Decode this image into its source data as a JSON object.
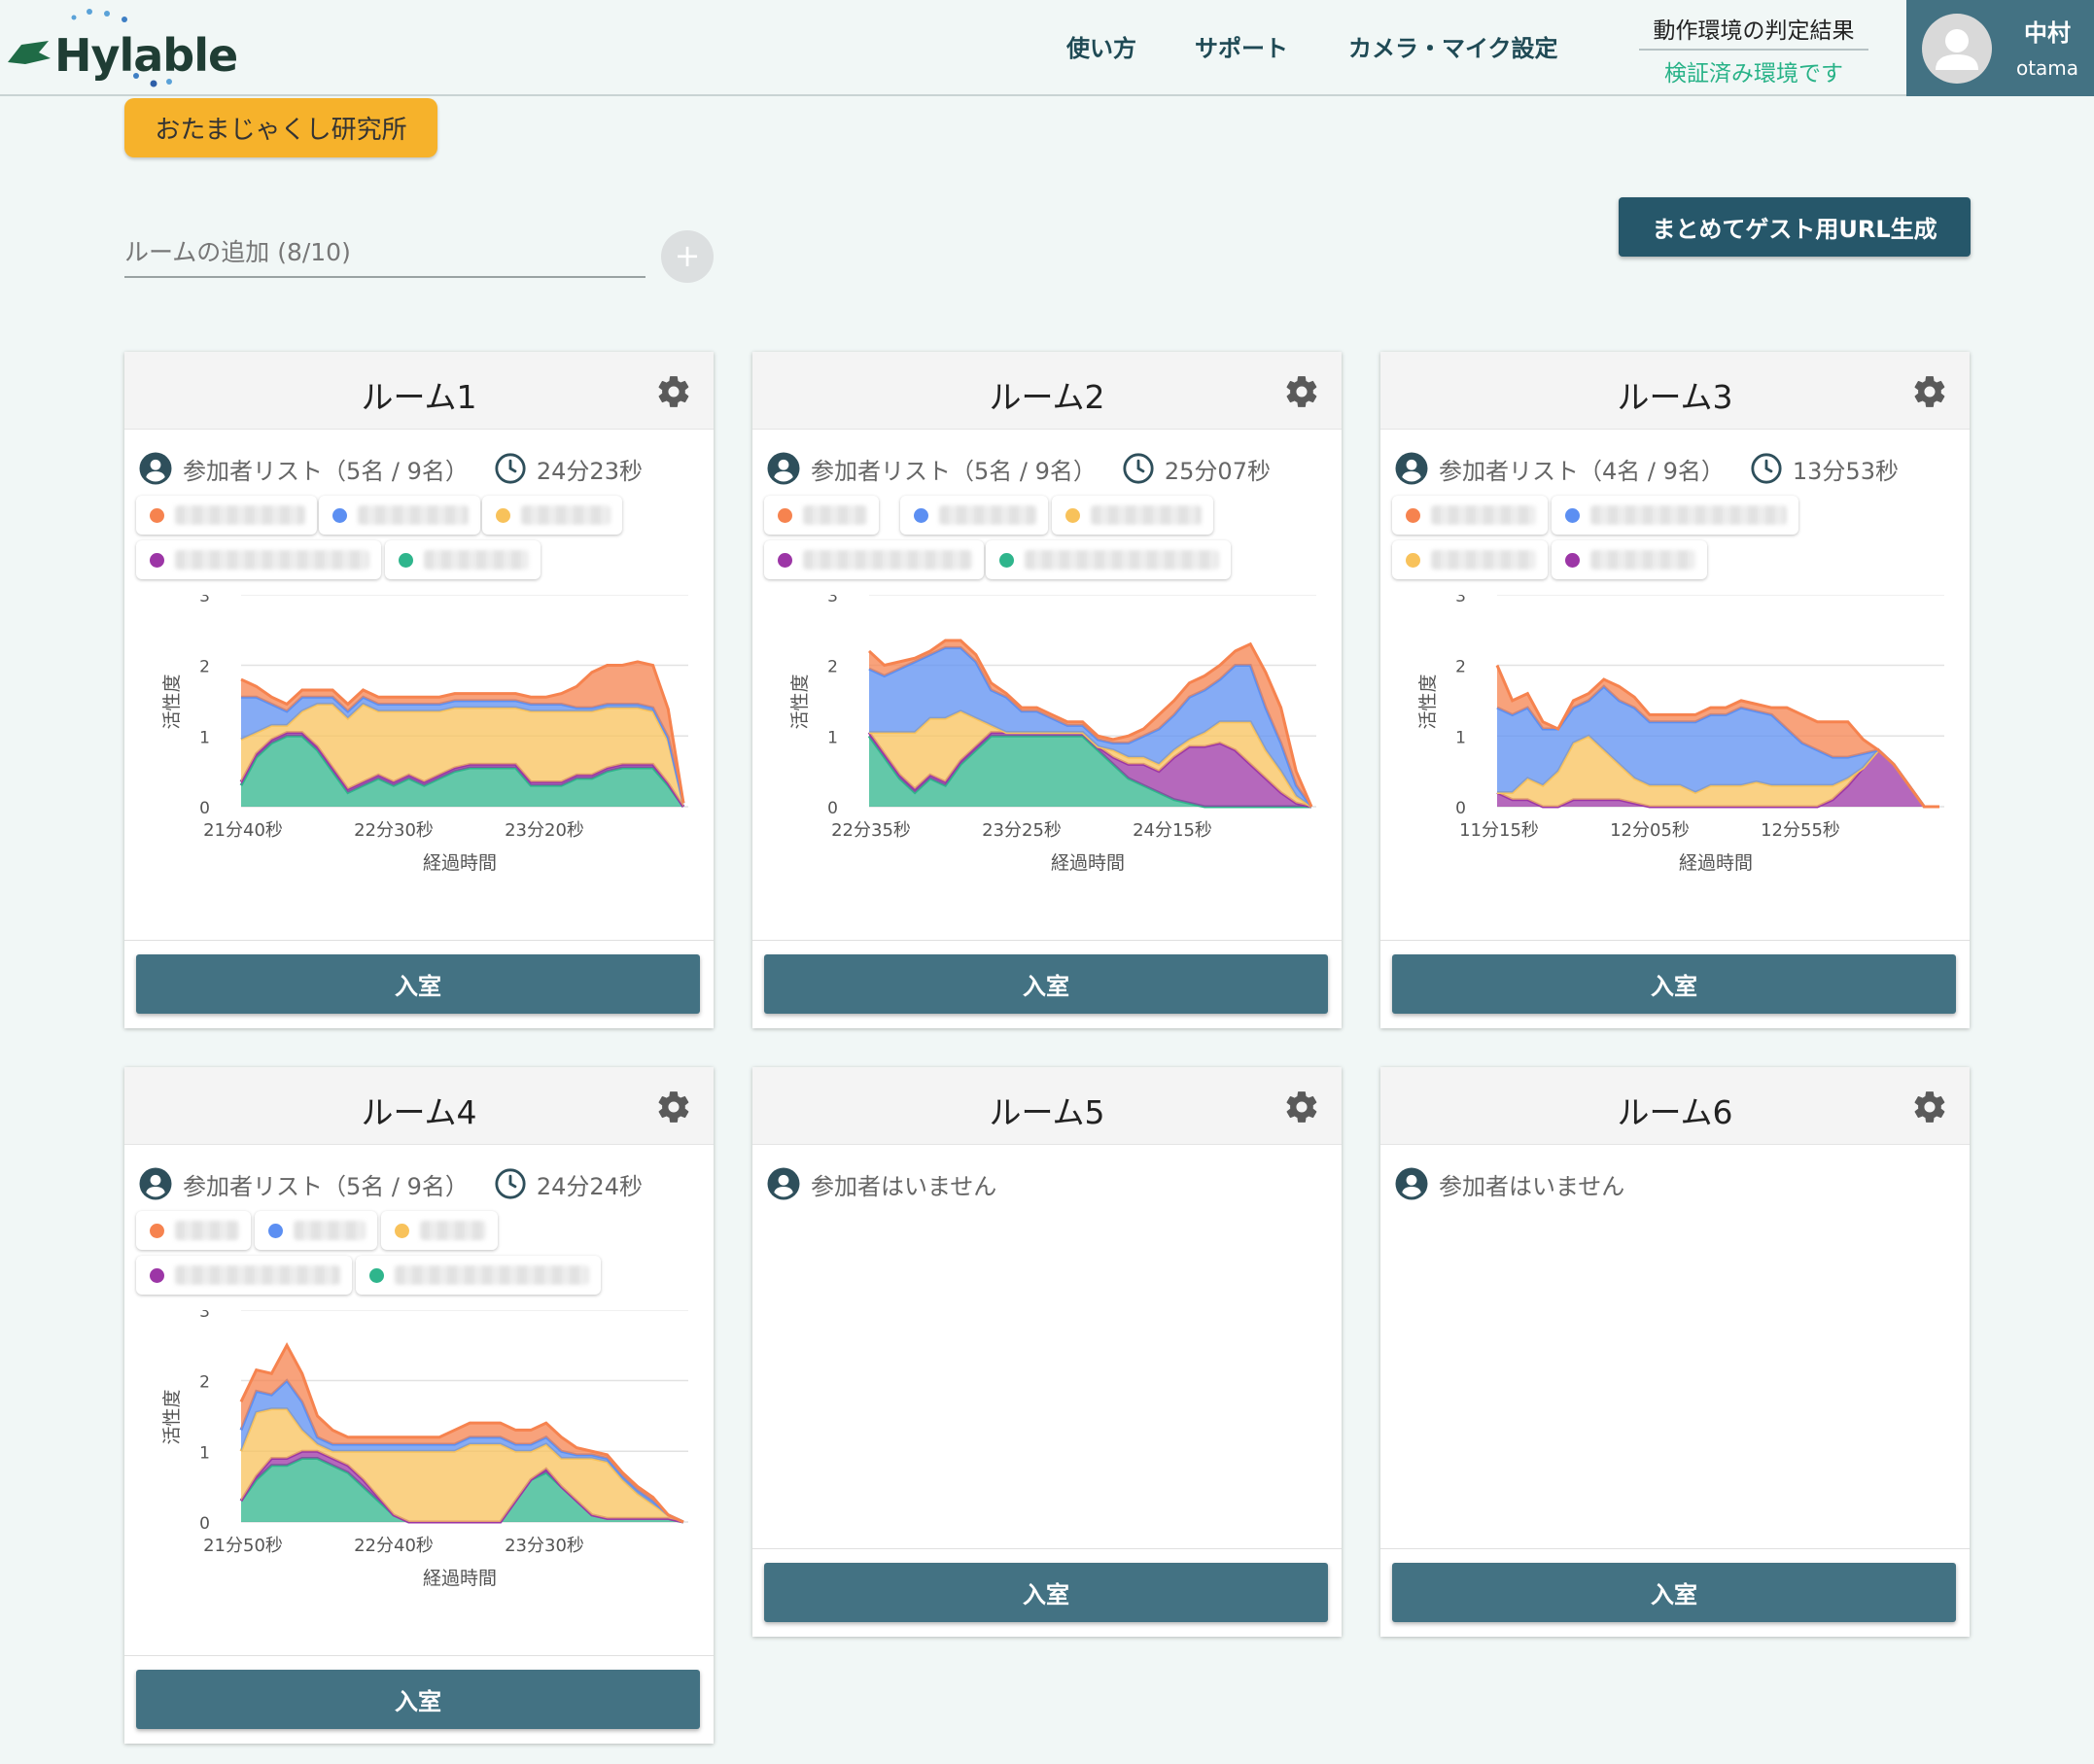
{
  "header": {
    "logo_text": "Hylable",
    "nav": [
      "使い方",
      "サポート",
      "カメラ・マイク設定"
    ],
    "env_title": "動作環境の判定結果",
    "env_status": "検証済み環境です",
    "user_name": "中村",
    "user_id": "otama"
  },
  "org_label": "おたまじゃくし研究所",
  "add_room": {
    "label": "ルームの追加 (8/10)",
    "plus": "+"
  },
  "guest_url_button": "まとめてゲスト用URL生成",
  "colors": {
    "orange": "#f6834f",
    "blue": "#5c8ff2",
    "yellow": "#f8c25b",
    "purple": "#9c36a6",
    "green": "#2fb58c"
  },
  "rooms": [
    {
      "title": "ルーム1",
      "participants_label": "参加者リスト（5名 / 9名）",
      "duration": "24分23秒",
      "chips": [
        "orange",
        "blue",
        "yellow",
        "purple",
        "green"
      ],
      "enter_label": "入室",
      "chart_data": {
        "type": "area",
        "stacked": true,
        "ylabel": "活性度",
        "xlabel": "経過時間",
        "ylim": [
          0,
          3
        ],
        "yticks": [
          "0",
          "1",
          "2",
          "3"
        ],
        "xticks": [
          {
            "at": 0,
            "label": "21分40秒"
          },
          {
            "at": 10,
            "label": "22分30秒"
          },
          {
            "at": 20,
            "label": "23分20秒"
          }
        ],
        "x_count": 30,
        "series": [
          {
            "color": "green",
            "values": [
              0.3,
              0.7,
              0.9,
              1.0,
              1.0,
              0.8,
              0.5,
              0.2,
              0.3,
              0.4,
              0.3,
              0.4,
              0.3,
              0.4,
              0.5,
              0.55,
              0.55,
              0.55,
              0.55,
              0.3,
              0.3,
              0.3,
              0.4,
              0.4,
              0.5,
              0.55,
              0.55,
              0.55,
              0.3,
              0.0
            ]
          },
          {
            "color": "purple",
            "values": [
              0.05,
              0.05,
              0.05,
              0.05,
              0.05,
              0.05,
              0.05,
              0.05,
              0.05,
              0.05,
              0.05,
              0.05,
              0.05,
              0.05,
              0.05,
              0.05,
              0.05,
              0.05,
              0.05,
              0.05,
              0.05,
              0.05,
              0.05,
              0.05,
              0.05,
              0.05,
              0.05,
              0.05,
              0.03,
              0.0
            ]
          },
          {
            "color": "yellow",
            "values": [
              0.6,
              0.3,
              0.2,
              0.1,
              0.3,
              0.6,
              0.9,
              1.0,
              1.1,
              0.9,
              1.0,
              0.9,
              1.0,
              0.9,
              0.85,
              0.8,
              0.8,
              0.8,
              0.8,
              1.0,
              1.0,
              1.0,
              0.9,
              0.9,
              0.85,
              0.8,
              0.8,
              0.75,
              0.6,
              0.05
            ]
          },
          {
            "color": "blue",
            "values": [
              0.6,
              0.5,
              0.3,
              0.2,
              0.2,
              0.1,
              0.1,
              0.1,
              0.1,
              0.1,
              0.1,
              0.1,
              0.1,
              0.1,
              0.1,
              0.1,
              0.1,
              0.1,
              0.1,
              0.1,
              0.1,
              0.1,
              0.05,
              0.05,
              0.05,
              0.05,
              0.05,
              0.05,
              0.05,
              0.0
            ]
          },
          {
            "color": "orange",
            "values": [
              0.25,
              0.15,
              0.1,
              0.1,
              0.1,
              0.1,
              0.1,
              0.1,
              0.1,
              0.1,
              0.1,
              0.1,
              0.1,
              0.1,
              0.1,
              0.1,
              0.1,
              0.1,
              0.1,
              0.1,
              0.1,
              0.15,
              0.3,
              0.5,
              0.55,
              0.55,
              0.6,
              0.6,
              0.4,
              0.0
            ]
          }
        ]
      }
    },
    {
      "title": "ルーム2",
      "participants_label": "参加者リスト（5名 / 9名）",
      "duration": "25分07秒",
      "chips": [
        "orange",
        "blue",
        "yellow",
        "purple",
        "green"
      ],
      "enter_label": "入室",
      "chart_data": {
        "type": "area",
        "stacked": true,
        "ylabel": "活性度",
        "xlabel": "経過時間",
        "ylim": [
          0,
          3
        ],
        "yticks": [
          "0",
          "1",
          "2",
          "3"
        ],
        "xticks": [
          {
            "at": 0,
            "label": "22分35秒"
          },
          {
            "at": 10,
            "label": "23分25秒"
          },
          {
            "at": 20,
            "label": "24分15秒"
          }
        ],
        "x_count": 30,
        "series": [
          {
            "color": "green",
            "values": [
              1.0,
              0.7,
              0.4,
              0.2,
              0.4,
              0.3,
              0.6,
              0.8,
              1.0,
              1.0,
              1.0,
              1.0,
              1.0,
              1.0,
              1.0,
              0.8,
              0.6,
              0.4,
              0.3,
              0.2,
              0.1,
              0.05,
              0.0,
              0.0,
              0.0,
              0.0,
              0.0,
              0.0,
              0.0,
              0.0
            ]
          },
          {
            "color": "purple",
            "values": [
              0.05,
              0.05,
              0.05,
              0.05,
              0.05,
              0.05,
              0.05,
              0.05,
              0.05,
              0.05,
              0.05,
              0.05,
              0.05,
              0.05,
              0.05,
              0.05,
              0.1,
              0.2,
              0.3,
              0.3,
              0.6,
              0.8,
              0.85,
              0.9,
              0.8,
              0.6,
              0.4,
              0.2,
              0.05,
              0.0
            ]
          },
          {
            "color": "yellow",
            "values": [
              0.0,
              0.3,
              0.6,
              0.8,
              0.8,
              0.9,
              0.7,
              0.4,
              0.1,
              0.0,
              0.0,
              0.0,
              0.0,
              0.0,
              0.0,
              0.0,
              0.1,
              0.1,
              0.1,
              0.1,
              0.1,
              0.1,
              0.2,
              0.3,
              0.4,
              0.6,
              0.4,
              0.3,
              0.1,
              0.0
            ]
          },
          {
            "color": "blue",
            "values": [
              0.9,
              0.8,
              0.9,
              1.0,
              0.9,
              1.0,
              0.9,
              0.8,
              0.5,
              0.5,
              0.3,
              0.3,
              0.2,
              0.1,
              0.1,
              0.1,
              0.1,
              0.2,
              0.3,
              0.5,
              0.5,
              0.6,
              0.6,
              0.6,
              0.8,
              0.8,
              0.6,
              0.4,
              0.15,
              0.0
            ]
          },
          {
            "color": "orange",
            "values": [
              0.25,
              0.15,
              0.1,
              0.05,
              0.05,
              0.1,
              0.1,
              0.1,
              0.1,
              0.05,
              0.05,
              0.05,
              0.05,
              0.05,
              0.05,
              0.05,
              0.05,
              0.1,
              0.1,
              0.2,
              0.2,
              0.2,
              0.2,
              0.2,
              0.2,
              0.3,
              0.5,
              0.5,
              0.2,
              0.0
            ]
          }
        ]
      }
    },
    {
      "title": "ルーム3",
      "participants_label": "参加者リスト（4名 / 9名）",
      "duration": "13分53秒",
      "chips": [
        "orange",
        "blue",
        "yellow",
        "purple"
      ],
      "enter_label": "入室",
      "chart_data": {
        "type": "area",
        "stacked": true,
        "ylabel": "活性度",
        "xlabel": "経過時間",
        "ylim": [
          0,
          3
        ],
        "yticks": [
          "0",
          "1",
          "2",
          "3"
        ],
        "xticks": [
          {
            "at": 0,
            "label": "11分15秒"
          },
          {
            "at": 10,
            "label": "12分05秒"
          },
          {
            "at": 20,
            "label": "12分55秒"
          }
        ],
        "x_count": 30,
        "series": [
          {
            "color": "purple",
            "values": [
              0.2,
              0.1,
              0.1,
              0.0,
              0.0,
              0.1,
              0.1,
              0.1,
              0.1,
              0.05,
              0.0,
              0.0,
              0.0,
              0.0,
              0.0,
              0.0,
              0.0,
              0.0,
              0.0,
              0.0,
              0.0,
              0.0,
              0.1,
              0.3,
              0.55,
              0.8,
              0.6,
              0.3,
              0.0,
              0.0
            ]
          },
          {
            "color": "yellow",
            "values": [
              0.0,
              0.1,
              0.3,
              0.3,
              0.5,
              0.8,
              0.9,
              0.7,
              0.5,
              0.35,
              0.3,
              0.3,
              0.3,
              0.2,
              0.3,
              0.3,
              0.3,
              0.35,
              0.3,
              0.3,
              0.3,
              0.3,
              0.2,
              0.1,
              0.0,
              0.0,
              0.0,
              0.0,
              0.0,
              0.0
            ]
          },
          {
            "color": "blue",
            "values": [
              1.2,
              1.1,
              1.0,
              0.8,
              0.6,
              0.5,
              0.5,
              0.9,
              0.9,
              1.0,
              0.9,
              0.9,
              0.9,
              1.0,
              1.0,
              1.0,
              1.1,
              1.0,
              1.0,
              0.8,
              0.6,
              0.5,
              0.4,
              0.3,
              0.2,
              0.0,
              0.0,
              0.0,
              0.0,
              0.0
            ]
          },
          {
            "color": "orange",
            "values": [
              0.6,
              0.2,
              0.2,
              0.1,
              0.0,
              0.1,
              0.1,
              0.1,
              0.2,
              0.15,
              0.1,
              0.1,
              0.1,
              0.1,
              0.1,
              0.1,
              0.1,
              0.1,
              0.1,
              0.3,
              0.4,
              0.4,
              0.5,
              0.5,
              0.2,
              0.0,
              0.0,
              0.0,
              0.0,
              0.0
            ]
          }
        ]
      }
    },
    {
      "title": "ルーム4",
      "participants_label": "参加者リスト（5名 / 9名）",
      "duration": "24分24秒",
      "chips": [
        "orange",
        "blue",
        "yellow",
        "purple",
        "green"
      ],
      "enter_label": "入室",
      "chart_data": {
        "type": "area",
        "stacked": true,
        "ylabel": "活性度",
        "xlabel": "経過時間",
        "ylim": [
          0,
          3
        ],
        "yticks": [
          "0",
          "1",
          "2",
          "3"
        ],
        "xticks": [
          {
            "at": 0,
            "label": "21分50秒"
          },
          {
            "at": 10,
            "label": "22分40秒"
          },
          {
            "at": 20,
            "label": "23分30秒"
          }
        ],
        "x_count": 30,
        "series": [
          {
            "color": "green",
            "values": [
              0.3,
              0.6,
              0.8,
              0.8,
              0.9,
              0.9,
              0.8,
              0.7,
              0.5,
              0.3,
              0.1,
              0.0,
              0.0,
              0.0,
              0.0,
              0.0,
              0.0,
              0.0,
              0.3,
              0.6,
              0.7,
              0.5,
              0.3,
              0.1,
              0.05,
              0.05,
              0.05,
              0.05,
              0.05,
              0.0
            ]
          },
          {
            "color": "purple",
            "values": [
              0.0,
              0.05,
              0.1,
              0.1,
              0.1,
              0.1,
              0.1,
              0.1,
              0.1,
              0.05,
              0.0,
              0.0,
              0.0,
              0.0,
              0.0,
              0.0,
              0.0,
              0.0,
              0.0,
              0.0,
              0.05,
              0.0,
              0.0,
              0.0,
              0.0,
              0.0,
              0.0,
              0.0,
              0.0,
              0.0
            ]
          },
          {
            "color": "yellow",
            "values": [
              0.7,
              0.9,
              0.7,
              0.7,
              0.3,
              0.1,
              0.1,
              0.2,
              0.4,
              0.65,
              0.9,
              1.0,
              1.0,
              1.0,
              1.0,
              1.1,
              1.1,
              1.1,
              0.7,
              0.4,
              0.35,
              0.4,
              0.6,
              0.8,
              0.8,
              0.55,
              0.35,
              0.2,
              0.05,
              0.0
            ]
          },
          {
            "color": "blue",
            "values": [
              0.3,
              0.3,
              0.2,
              0.4,
              0.4,
              0.1,
              0.1,
              0.1,
              0.1,
              0.1,
              0.1,
              0.1,
              0.1,
              0.1,
              0.1,
              0.1,
              0.1,
              0.1,
              0.1,
              0.1,
              0.1,
              0.1,
              0.05,
              0.05,
              0.05,
              0.05,
              0.05,
              0.05,
              0.0,
              0.0
            ]
          },
          {
            "color": "orange",
            "values": [
              0.4,
              0.3,
              0.3,
              0.5,
              0.4,
              0.3,
              0.2,
              0.1,
              0.1,
              0.1,
              0.1,
              0.1,
              0.1,
              0.1,
              0.2,
              0.2,
              0.2,
              0.2,
              0.2,
              0.2,
              0.2,
              0.2,
              0.1,
              0.05,
              0.05,
              0.05,
              0.05,
              0.05,
              0.0,
              0.0
            ]
          }
        ]
      }
    },
    {
      "title": "ルーム5",
      "participants_label": "参加者はいません",
      "enter_label": "入室"
    },
    {
      "title": "ルーム6",
      "participants_label": "参加者はいません",
      "enter_label": "入室"
    }
  ]
}
